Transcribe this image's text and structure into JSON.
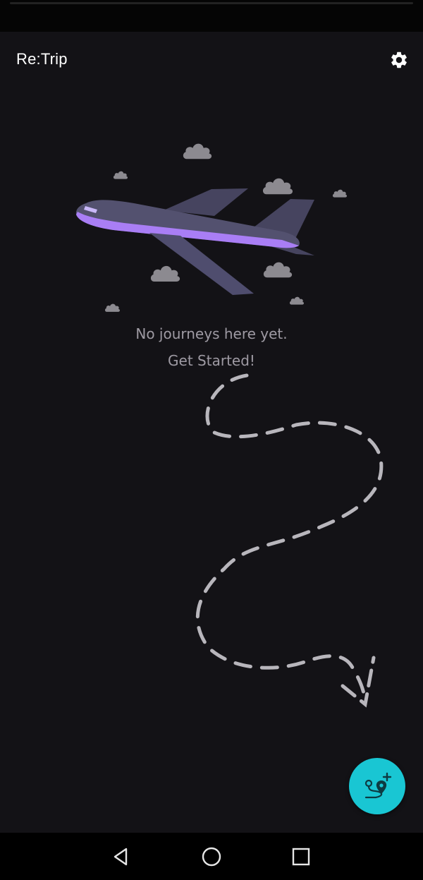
{
  "app": {
    "title": "Re:Trip"
  },
  "header": {
    "settings_icon": "gear-icon"
  },
  "empty_state": {
    "illustration": "airplane-with-clouds",
    "line1": "No journeys here yet.",
    "line2": "Get Started!",
    "decoration": "dashed-path-arrow"
  },
  "fab": {
    "icon": "add-location-route-icon"
  },
  "navigation_bar": {
    "back_icon": "back-triangle-icon",
    "home_icon": "home-circle-icon",
    "recents_icon": "recents-square-icon"
  },
  "colors": {
    "background": "#131216",
    "fab": "#19c6d3",
    "plane_body": "#4f4d6e",
    "plane_stripe": "#a97ef5",
    "cloud": "#8c8a90",
    "text_muted": "#9e9aa3",
    "dashed_path": "#b8b6bc"
  }
}
